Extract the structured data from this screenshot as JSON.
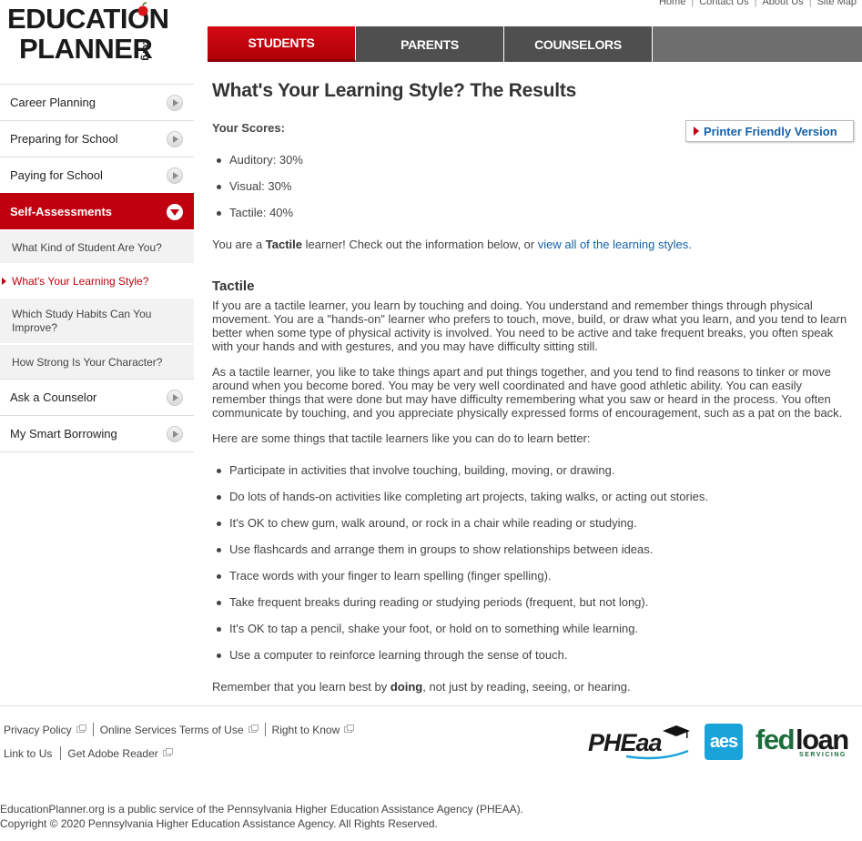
{
  "logo": {
    "line1": "EDUCATION",
    "line2": "PLANNER",
    "suffix": ".org",
    "sm": "SM"
  },
  "utility_nav": [
    "Home",
    "Contact Us",
    "About Us",
    "Site Map"
  ],
  "top_tabs": [
    {
      "label": "STUDENTS",
      "active": true
    },
    {
      "label": "PARENTS",
      "active": false
    },
    {
      "label": "COUNSELORS",
      "active": false
    }
  ],
  "sidebar": {
    "items": [
      {
        "label": "Career Planning"
      },
      {
        "label": "Preparing for School"
      },
      {
        "label": "Paying for School"
      },
      {
        "label": "Self-Assessments"
      }
    ],
    "subitems": [
      {
        "label": "What Kind of Student Are You?"
      },
      {
        "label": "What's Your Learning Style?"
      },
      {
        "label": "Which Study Habits Can You Improve?"
      },
      {
        "label": "How Strong Is Your Character?"
      }
    ],
    "after": [
      {
        "label": "Ask a Counselor"
      },
      {
        "label": "My Smart Borrowing"
      }
    ]
  },
  "main": {
    "title": "What's Your Learning Style? The Results",
    "scores_label": "Your Scores:",
    "print_label": "Printer Friendly Version",
    "scores": [
      "Auditory: 30%",
      "Visual: 30%",
      "Tactile: 40%"
    ],
    "result": {
      "pre": "You are a ",
      "style": "Tactile",
      "mid": " learner! Check out the information below, or ",
      "link": "view all of the learning styles",
      "post": "."
    },
    "section_heading": "Tactile",
    "para1": "If you are a tactile learner, you learn by touching and doing. You understand and remember things through physical movement. You are a \"hands-on\" learner who prefers to touch, move, build, or draw what you learn, and you tend to learn better when some type of physical activity is involved. You need to be active and take frequent breaks, you often speak with your hands and with gestures, and you may have difficulty sitting still.",
    "para2": "As a tactile learner, you like to take things apart and put things together, and you tend to find reasons to tinker or move around when you become bored. You may be very well coordinated and have good athletic ability. You can easily remember things that were done but may have difficulty remembering what you saw or heard in the process. You often communicate by touching, and you appreciate physically expressed forms of encouragement, such as a pat on the back.",
    "tips_intro": "Here are some things that tactile learners like you can do to learn better:",
    "tips": [
      "Participate in activities that involve touching, building, moving, or drawing.",
      "Do lots of hands-on activities like completing art projects, taking walks, or acting out stories.",
      "It's OK to chew gum, walk around, or rock in a chair while reading or studying.",
      "Use flashcards and arrange them in groups to show relationships between ideas.",
      "Trace words with your finger to learn spelling (finger spelling).",
      "Take frequent breaks during reading or studying periods (frequent, but not long).",
      "It's OK to tap a pencil, shake your foot, or hold on to something while learning.",
      "Use a computer to reinforce learning through the sense of touch."
    ],
    "closing": {
      "pre": "Remember that you learn best by ",
      "bold": "doing",
      "post": ", not just by reading, seeing, or hearing."
    }
  },
  "footer": {
    "links_row1": [
      "Privacy Policy",
      "Online Services Terms of Use",
      "Right to Know"
    ],
    "links_row2": [
      "Link to Us",
      "Get Adobe Reader"
    ],
    "copy1": "EducationPlanner.org is a public service of the Pennsylvania Higher Education Assistance Agency (PHEAA).",
    "copy2": "Copyright © 2020 Pennsylvania Higher Education Assistance Agency. All Rights Reserved.",
    "partners": {
      "pheaa": "PHEaa",
      "aes": "aes",
      "fed": "fed",
      "loan": "loan",
      "servicing": "SERVICING"
    }
  },
  "colors": {
    "brand_red": "#c0000e",
    "link_blue": "#1560a8",
    "fedloan_green": "#1b6e3a",
    "aes_blue": "#1aa3d9"
  }
}
